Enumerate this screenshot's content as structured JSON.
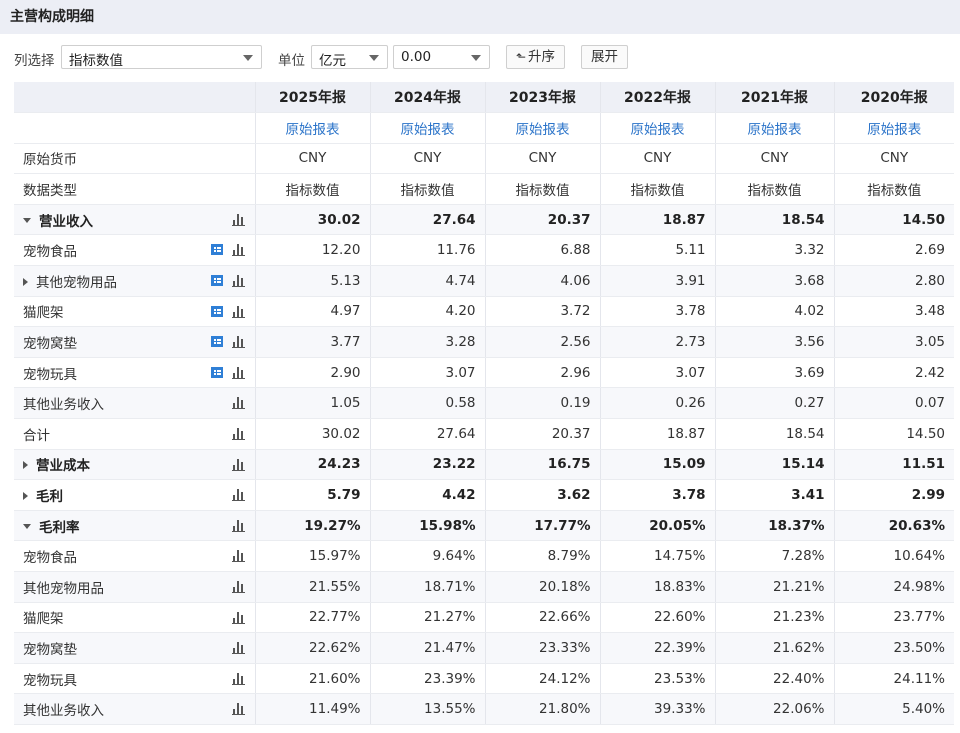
{
  "panel_title": "主营构成明细",
  "toolbar": {
    "column_label": "列选择",
    "column_select": "指标数值",
    "unit_label": "单位",
    "unit_select": "亿元",
    "decimal_select": "0.00",
    "sort_button": "升序",
    "expand_button": "展开"
  },
  "columns": [
    "2025年报",
    "2024年报",
    "2023年报",
    "2022年报",
    "2021年报",
    "2020年报"
  ],
  "meta_rows": [
    {
      "label": "",
      "values": [
        "原始报表",
        "原始报表",
        "原始报表",
        "原始报表",
        "原始报表",
        "原始报表"
      ]
    },
    {
      "label": "原始货币",
      "values": [
        "CNY",
        "CNY",
        "CNY",
        "CNY",
        "CNY",
        "CNY"
      ]
    },
    {
      "label": "数据类型",
      "values": [
        "指标数值",
        "指标数值",
        "指标数值",
        "指标数值",
        "指标数值",
        "指标数值"
      ]
    }
  ],
  "rows": [
    {
      "label": "营业收入",
      "values": [
        "30.02",
        "27.64",
        "20.37",
        "18.87",
        "18.54",
        "14.50"
      ]
    },
    {
      "label": "宠物食品",
      "values": [
        "12.20",
        "11.76",
        "6.88",
        "5.11",
        "3.32",
        "2.69"
      ]
    },
    {
      "label": "其他宠物用品",
      "values": [
        "5.13",
        "4.74",
        "4.06",
        "3.91",
        "3.68",
        "2.80"
      ]
    },
    {
      "label": "猫爬架",
      "values": [
        "4.97",
        "4.20",
        "3.72",
        "3.78",
        "4.02",
        "3.48"
      ]
    },
    {
      "label": "宠物窝垫",
      "values": [
        "3.77",
        "3.28",
        "2.56",
        "2.73",
        "3.56",
        "3.05"
      ]
    },
    {
      "label": "宠物玩具",
      "values": [
        "2.90",
        "3.07",
        "2.96",
        "3.07",
        "3.69",
        "2.42"
      ]
    },
    {
      "label": "其他业务收入",
      "values": [
        "1.05",
        "0.58",
        "0.19",
        "0.26",
        "0.27",
        "0.07"
      ]
    },
    {
      "label": "合计",
      "values": [
        "30.02",
        "27.64",
        "20.37",
        "18.87",
        "18.54",
        "14.50"
      ]
    },
    {
      "label": "营业成本",
      "values": [
        "24.23",
        "23.22",
        "16.75",
        "15.09",
        "15.14",
        "11.51"
      ]
    },
    {
      "label": "毛利",
      "values": [
        "5.79",
        "4.42",
        "3.62",
        "3.78",
        "3.41",
        "2.99"
      ]
    },
    {
      "label": "毛利率",
      "values": [
        "19.27%",
        "15.98%",
        "17.77%",
        "20.05%",
        "18.37%",
        "20.63%"
      ]
    },
    {
      "label": "宠物食品",
      "values": [
        "15.97%",
        "9.64%",
        "8.79%",
        "14.75%",
        "7.28%",
        "10.64%"
      ]
    },
    {
      "label": "其他宠物用品",
      "values": [
        "21.55%",
        "18.71%",
        "20.18%",
        "18.83%",
        "21.21%",
        "24.98%"
      ]
    },
    {
      "label": "猫爬架",
      "values": [
        "22.77%",
        "21.27%",
        "22.66%",
        "22.60%",
        "21.23%",
        "23.77%"
      ]
    },
    {
      "label": "宠物窝垫",
      "values": [
        "22.62%",
        "21.47%",
        "23.33%",
        "22.39%",
        "21.62%",
        "23.50%"
      ]
    },
    {
      "label": "宠物玩具",
      "values": [
        "21.60%",
        "23.39%",
        "24.12%",
        "23.53%",
        "22.40%",
        "24.11%"
      ]
    },
    {
      "label": "其他业务收入",
      "values": [
        "11.49%",
        "13.55%",
        "21.80%",
        "39.33%",
        "22.06%",
        "5.40%"
      ]
    }
  ],
  "colors": {
    "header_bg": "#eef0f6",
    "title_bg": "#eceef5",
    "link": "#2a73c9",
    "table_icon": "#2f7fd6"
  }
}
